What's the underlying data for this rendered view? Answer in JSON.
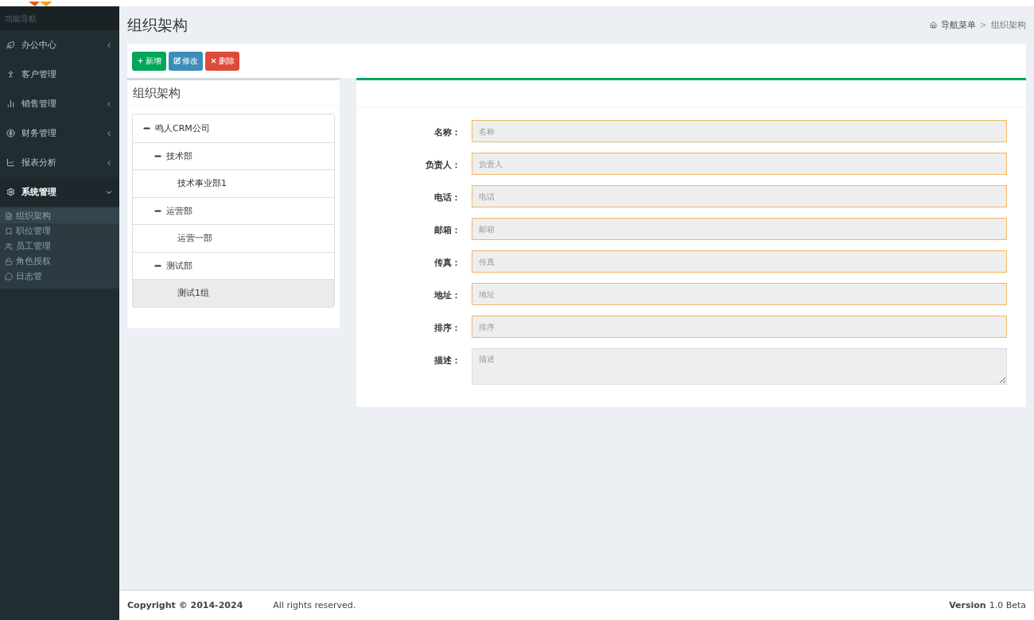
{
  "sidebar": {
    "header": "功能导航",
    "items": [
      {
        "label": "办公中心",
        "has_submenu": true,
        "expanded": false
      },
      {
        "label": "客户管理",
        "has_submenu": false,
        "expanded": false
      },
      {
        "label": "销售管理",
        "has_submenu": true,
        "expanded": false
      },
      {
        "label": "财务管理",
        "has_submenu": true,
        "expanded": false
      },
      {
        "label": "报表分析",
        "has_submenu": true,
        "expanded": false
      },
      {
        "label": "系统管理",
        "has_submenu": true,
        "expanded": true,
        "children": [
          {
            "label": "组织架构",
            "selected": true
          },
          {
            "label": "职位管理",
            "selected": false
          },
          {
            "label": "员工管理",
            "selected": false
          },
          {
            "label": "角色授权",
            "selected": false
          },
          {
            "label": "日志管",
            "selected": false
          }
        ]
      }
    ]
  },
  "page_title": "组织架构",
  "breadcrumb": [
    "导航菜单",
    "组织架构"
  ],
  "breadcrumb_separator": ">",
  "toolbar": [
    {
      "label": "新增",
      "kind": "add"
    },
    {
      "label": "修改",
      "kind": "edit"
    },
    {
      "label": "删除",
      "kind": "delete"
    }
  ],
  "tree_panel": {
    "title": "组织架构",
    "nodes": [
      {
        "label": "鸣人CRM公司",
        "expanded": true,
        "selected": false,
        "children": [
          {
            "label": "技术部",
            "expanded": true,
            "selected": false,
            "children": [
              {
                "label": "技术事业部1",
                "selected": false
              }
            ]
          },
          {
            "label": "运营部",
            "expanded": true,
            "selected": false,
            "children": [
              {
                "label": "运营一部",
                "selected": false
              }
            ]
          },
          {
            "label": "测试部",
            "expanded": true,
            "selected": false,
            "children": [
              {
                "label": "测试1组",
                "selected": true
              }
            ]
          }
        ]
      }
    ]
  },
  "form": {
    "fields": [
      {
        "label": "名称：",
        "placeholder": "名称",
        "kind": "input",
        "highlighted": true
      },
      {
        "label": "负责人：",
        "placeholder": "负责人",
        "kind": "input",
        "highlighted": true
      },
      {
        "label": "电话：",
        "placeholder": "电话",
        "kind": "input",
        "highlighted": true
      },
      {
        "label": "邮箱：",
        "placeholder": "邮箱",
        "kind": "input",
        "highlighted": true
      },
      {
        "label": "传真：",
        "placeholder": "传真",
        "kind": "input",
        "highlighted": true
      },
      {
        "label": "地址：",
        "placeholder": "地址",
        "kind": "input",
        "highlighted": true
      },
      {
        "label": "排序：",
        "placeholder": "排序",
        "kind": "input",
        "highlighted": true
      },
      {
        "label": "描述：",
        "placeholder": "描述",
        "kind": "textarea",
        "highlighted": false
      }
    ]
  },
  "footer": {
    "copyright": "Copyright © 2014-2024",
    "rights": "All rights reserved.",
    "version_label": "Version",
    "version": "1.0 Beta"
  }
}
